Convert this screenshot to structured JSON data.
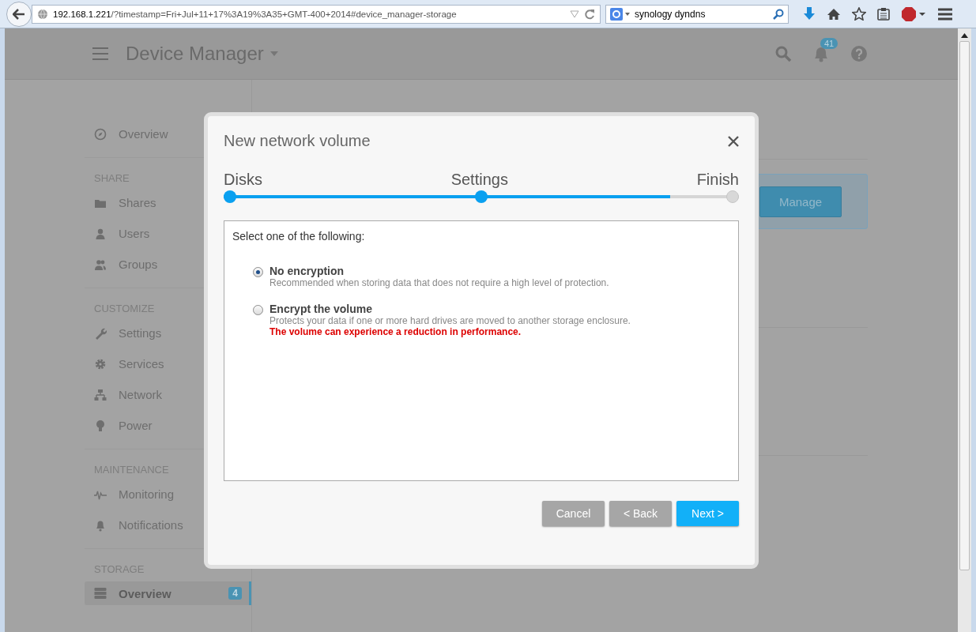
{
  "browser": {
    "url_host": "192.168.1.221",
    "url_path": "/?timestamp=Fri+Jul+11+17%3A19%3A35+GMT-400+2014#device_manager-storage",
    "search": "synology dyndns"
  },
  "header": {
    "title": "Device Manager",
    "notification_count": "41"
  },
  "sidebar": {
    "sections": [
      {
        "items": [
          {
            "label": "Overview",
            "selected": false
          }
        ]
      },
      {
        "heading": "SHARE",
        "items": [
          {
            "label": "Shares",
            "selected": false
          },
          {
            "label": "Users",
            "selected": false
          },
          {
            "label": "Groups",
            "selected": false
          }
        ]
      },
      {
        "heading": "CUSTOMIZE",
        "items": [
          {
            "label": "Settings",
            "selected": false
          },
          {
            "label": "Services",
            "selected": false
          },
          {
            "label": "Network",
            "selected": false
          },
          {
            "label": "Power",
            "selected": false
          }
        ]
      },
      {
        "heading": "MAINTENANCE",
        "items": [
          {
            "label": "Monitoring",
            "selected": false
          },
          {
            "label": "Notifications",
            "selected": false
          }
        ]
      },
      {
        "heading": "STORAGE",
        "items": [
          {
            "label": "Overview",
            "selected": true,
            "badge": "4"
          }
        ]
      }
    ]
  },
  "content": {
    "manage_button": "Manage"
  },
  "dialog": {
    "title": "New network volume",
    "steps": [
      {
        "label": "Disks",
        "reached": true
      },
      {
        "label": "Settings",
        "reached": true
      },
      {
        "label": "Finish",
        "reached": false
      }
    ],
    "progress": {
      "level": 0.866
    },
    "prompt": "Select one of the following:",
    "options": [
      {
        "label": "No encryption",
        "description": "Recommended when storing data that does not require a high level of protection.",
        "selected": true
      },
      {
        "label": "Encrypt the volume",
        "description": "Protects your data if one or more hard drives are moved to another storage enclosure.",
        "warning": "The volume can experience a reduction in performance.",
        "selected": false
      }
    ],
    "buttons": [
      {
        "label": "Cancel",
        "kind": "secondary"
      },
      {
        "label": "< Back",
        "kind": "secondary"
      },
      {
        "label": "Next >",
        "kind": "primary"
      }
    ]
  }
}
